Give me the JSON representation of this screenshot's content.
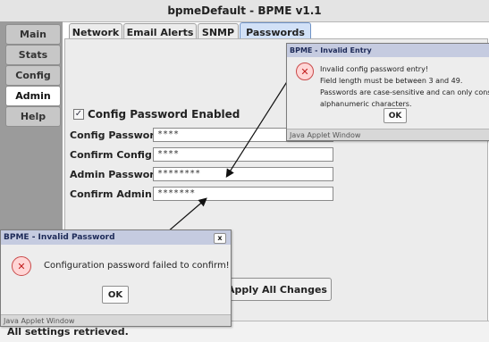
{
  "app": {
    "title": "bpmeDefault - BPME v1.1"
  },
  "sidebar": {
    "items": [
      {
        "label": "Main"
      },
      {
        "label": "Stats"
      },
      {
        "label": "Config"
      },
      {
        "label": "Admin"
      },
      {
        "label": "Help"
      }
    ]
  },
  "tabs": [
    {
      "label": "Network"
    },
    {
      "label": "Email Alerts"
    },
    {
      "label": "SNMP"
    },
    {
      "label": "Passwords"
    }
  ],
  "passwords": {
    "config_enabled_label": "Config Password Enabled",
    "config_password_label": "Config Password",
    "config_password_value": "****",
    "confirm_config_label": "Confirm Config",
    "confirm_config_value": "****",
    "admin_password_label": "Admin Password",
    "admin_password_value": "********",
    "confirm_admin_label": "Confirm Admin",
    "confirm_admin_value": "*******"
  },
  "apply_button": "Apply All Changes",
  "status": "All settings retrieved.",
  "dialog_entry": {
    "title": "BPME - Invalid Entry",
    "line1": "Invalid config password entry!",
    "line2": "Field length must be between 3 and 49.",
    "line3": "Passwords are case-sensitive and can only consist o",
    "line4": "alphanumeric characters.",
    "ok": "OK",
    "footer": "Java Applet Window"
  },
  "dialog_password": {
    "title": "BPME - Invalid Password",
    "message": "Configuration password failed to confirm!",
    "ok": "OK",
    "close": "x",
    "footer": "Java Applet Window"
  }
}
